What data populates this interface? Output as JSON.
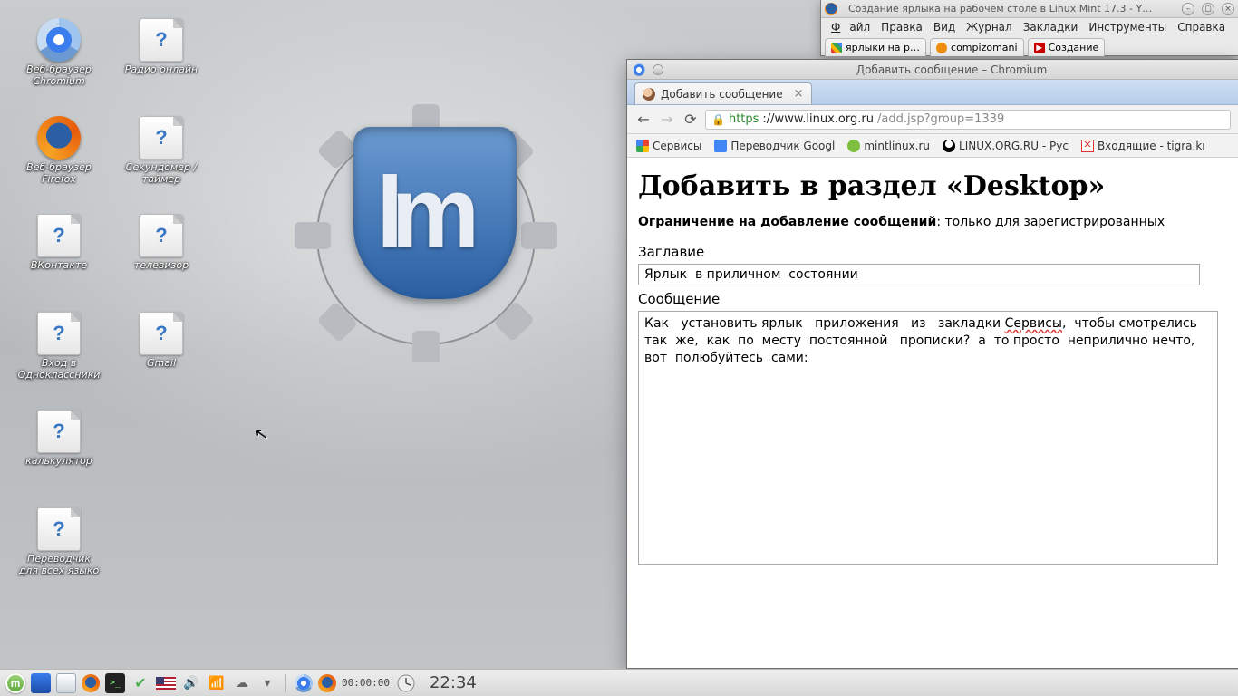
{
  "desktop_icons": {
    "chromium": "Веб-браузер\nChromium",
    "firefox": "Веб-браузер\nFirefox",
    "vk": "ВКонтакте",
    "odno": "Вход в\nОдноклассники",
    "calc": "калькулятор",
    "trans": "Переводчик\nдля всех языко",
    "radio": "Радио онлайн",
    "stop": "Секундомер /\nтаймер",
    "tv": "телевизор",
    "gmail": "Gmail"
  },
  "firefox": {
    "title": "Создание ярлыка на рабочем столе в Linux Mint 17.3 - Y…",
    "menu": {
      "file": "Файл",
      "edit": "Правка",
      "view": "Вид",
      "journal": "Журнал",
      "bookmarks": "Закладки",
      "tools": "Инструменты",
      "help": "Справка"
    },
    "tabs": {
      "t1": "ярлыки на р…",
      "t2": "compizomani",
      "t3": "Создание"
    }
  },
  "chromium": {
    "title": "Добавить сообщение – Chromium",
    "tab": "Добавить сообщение",
    "url": {
      "https": "https",
      "host": "://www.linux.org.ru",
      "path": "/add.jsp?group=1339"
    },
    "bookmarks": {
      "apps": "Сервисы",
      "goog": "Переводчик Googl",
      "mint": "mintlinux.ru",
      "lor": "LINUX.ORG.RU - Рус",
      "gmail": "Входящие - tigra.kı"
    }
  },
  "page": {
    "h1": "Добавить в раздел «Desktop»",
    "restrict_b": "Ограничение на добавление сообщений",
    "restrict_rest": ": только для зарегистрированных",
    "title_label": "Заглавие",
    "title_value": "Ярлык  в приличном  состоянии",
    "msg_label": "Сообщение",
    "msg_pre": "Как   установить ярлык   приложения   из   закладки ",
    "msg_err": "Сервисы",
    "msg_post": ",  чтобы смотрелись  так  же,  как  по  месту  постоянной   прописки?  а  то просто  неприлично нечто,  вот  полюбуйтесь  сами:"
  },
  "taskbar": {
    "timer": "00:00:00",
    "clock": "22:34"
  }
}
